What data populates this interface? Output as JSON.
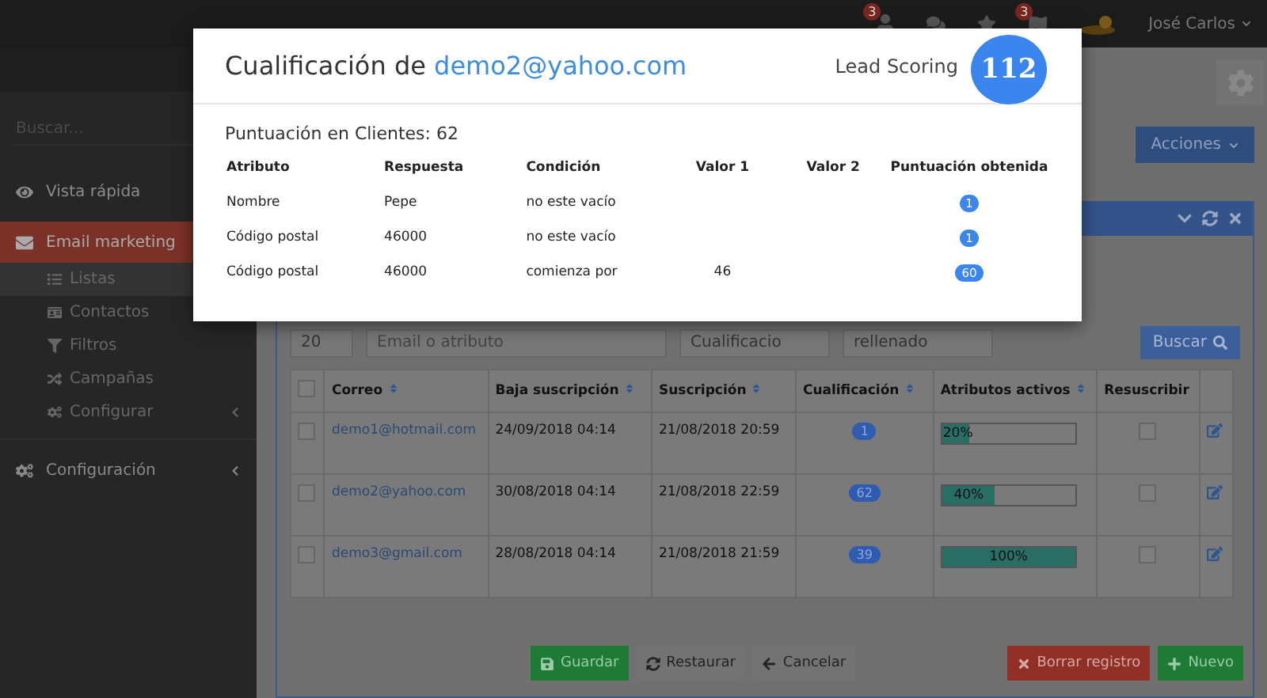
{
  "topbar": {
    "icons": [
      {
        "kind": "user",
        "count": "3"
      },
      {
        "kind": "chat"
      },
      {
        "kind": "star"
      },
      {
        "kind": "flag",
        "count": "3"
      }
    ],
    "user": "José Carlos"
  },
  "sidebar": {
    "search": {
      "placeholder": "Buscar..."
    },
    "items": [
      {
        "label": "Vista rápida",
        "selected": false
      },
      {
        "label": "Email marketing",
        "selected": true,
        "expanded": true,
        "children": [
          {
            "label": "Listas",
            "selected": true
          },
          {
            "label": "Contactos",
            "selected": false
          },
          {
            "label": "Filtros",
            "selected": false
          },
          {
            "label": "Campañas",
            "selected": false
          },
          {
            "label": "Configurar",
            "selected": false,
            "expanded": false
          }
        ]
      },
      {
        "label": "Configuración",
        "selected": false,
        "expanded": false
      }
    ]
  },
  "actions_button": "Acciones",
  "filters": {
    "fields": [
      {
        "value": "20"
      },
      {
        "placeholder": "Email o atributo"
      },
      {
        "value": "Cualificacio"
      },
      {
        "value": "rellenado"
      }
    ],
    "search_button": "Buscar"
  },
  "table": {
    "all_selected": false,
    "columns": [
      "Correo",
      "Baja suscripción",
      "Suscripción",
      "Cualificación",
      "Atributos activos",
      "Resuscribir"
    ],
    "rows": [
      {
        "selected": false,
        "email": "demo1@hotmail.com",
        "unsubscribed": "24/09/2018 04:14",
        "subscribed": "21/08/2018 20:59",
        "score": "1",
        "level": 0.2,
        "reading": "20%",
        "resubscribe": false
      },
      {
        "selected": false,
        "email": "demo2@yahoo.com",
        "unsubscribed": "30/08/2018 04:14",
        "subscribed": "21/08/2018 22:59",
        "score": "62",
        "level": 0.4,
        "reading": "40%",
        "resubscribe": false
      },
      {
        "selected": false,
        "email": "demo3@gmail.com",
        "unsubscribed": "28/08/2018 04:14",
        "subscribed": "21/08/2018 21:59",
        "score": "39",
        "level": 1,
        "reading": "100%",
        "resubscribe": false
      }
    ]
  },
  "footer_buttons": [
    {
      "label": "Guardar",
      "kind": "save"
    },
    {
      "label": "Restaurar",
      "kind": "reset"
    },
    {
      "label": "Cancelar",
      "kind": "cancel"
    },
    {
      "label": "Borrar registro",
      "kind": "delete"
    },
    {
      "label": "Nuevo",
      "kind": "new"
    }
  ],
  "modal": {
    "title": "Cualificación de",
    "email": "demo2@yahoo.com",
    "lead_label": "Lead Scoring",
    "lead_score": "112",
    "summary": "Puntuación en Clientes: 62",
    "columns": [
      "Atributo",
      "Respuesta",
      "Condición",
      "Valor 1",
      "Valor 2",
      "Puntuación obtenida"
    ],
    "rows": [
      {
        "attribute": "Nombre",
        "answer": "Pepe",
        "condition": "no este vacío",
        "points": "1"
      },
      {
        "attribute": "Código postal",
        "answer": "46000",
        "condition": "no este vacío",
        "points": "1"
      },
      {
        "attribute": "Código postal",
        "answer": "46000",
        "condition": "comienza por",
        "value1": "46",
        "points": "60"
      }
    ]
  }
}
